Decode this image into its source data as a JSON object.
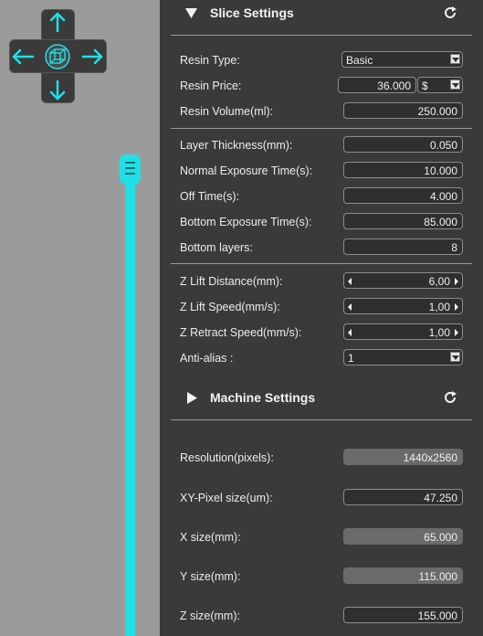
{
  "slice": {
    "title": "Slice Settings",
    "resin_type": {
      "label": "Resin Type:",
      "value": "Basic"
    },
    "resin_price": {
      "label": "Resin Price:",
      "value": "36.000",
      "currency": "$"
    },
    "resin_volume": {
      "label": "Resin Volume(ml):",
      "value": "250.000"
    },
    "layer_thickness": {
      "label": "Layer Thickness(mm):",
      "value": "0.050"
    },
    "normal_exposure": {
      "label": "Normal Exposure Time(s):",
      "value": "10.000"
    },
    "off_time": {
      "label": "Off Time(s):",
      "value": "4.000"
    },
    "bottom_exposure": {
      "label": "Bottom Exposure Time(s):",
      "value": "85.000"
    },
    "bottom_layers": {
      "label": "Bottom layers:",
      "value": "8"
    },
    "z_lift_distance": {
      "label": "Z Lift Distance(mm):",
      "value": "6,00"
    },
    "z_lift_speed": {
      "label": "Z Lift Speed(mm/s):",
      "value": "1,00"
    },
    "z_retract_speed": {
      "label": "Z Retract Speed(mm/s):",
      "value": "1,00"
    },
    "anti_alias": {
      "label": "Anti-alias :",
      "value": "1"
    }
  },
  "machine": {
    "title": "Machine Settings",
    "resolution": {
      "label": "Resolution(pixels):",
      "value": "1440x2560"
    },
    "xy_pixel": {
      "label": "XY-Pixel size(um):",
      "value": "47.250"
    },
    "x_size": {
      "label": "X size(mm):",
      "value": "65.000"
    },
    "y_size": {
      "label": "Y size(mm):",
      "value": "115.000"
    },
    "z_size": {
      "label": "Z size(mm):",
      "value": "155.000"
    }
  },
  "colors": {
    "accent": "#20e0e6",
    "panel": "#3a3a3a",
    "viewport": "#9b9b9b"
  }
}
